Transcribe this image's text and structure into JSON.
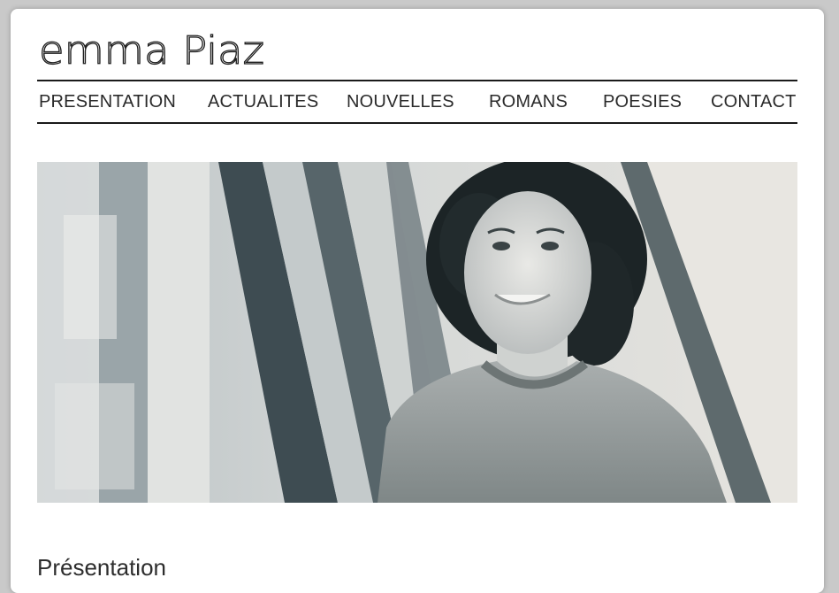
{
  "site": {
    "brand_name": "emma Piaz"
  },
  "nav": {
    "items": [
      {
        "label": "PRESENTATION"
      },
      {
        "label": "ACTUALITES"
      },
      {
        "label": "NOUVELLES"
      },
      {
        "label": "ROMANS"
      },
      {
        "label": "POESIES"
      },
      {
        "label": "CONTACT"
      }
    ]
  },
  "hero": {
    "image_subject": "portrait-photo-monochrome"
  },
  "main": {
    "section_title": "Présentation"
  },
  "colors": {
    "page_background": "#c9c9c9",
    "card_background": "#ffffff",
    "text": "#2a2a2a",
    "rule": "#1a1a1a"
  }
}
